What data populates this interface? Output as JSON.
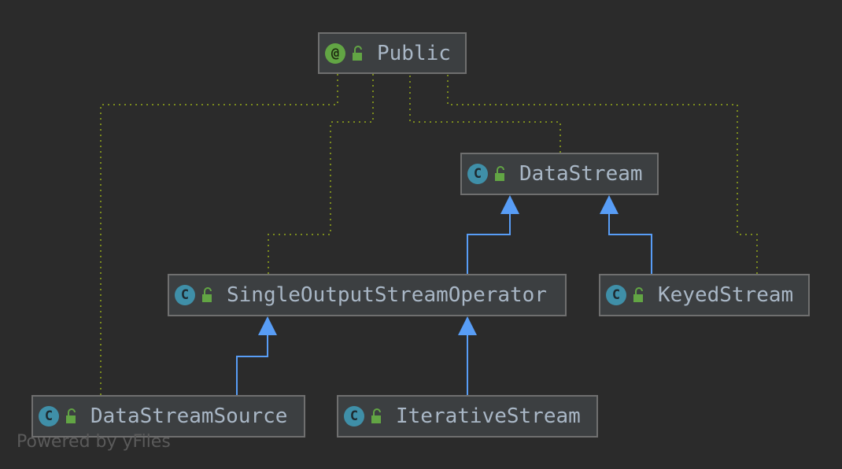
{
  "nodes": {
    "public": {
      "name": "Public",
      "kind": "annotation",
      "kind_letter": "@"
    },
    "datastream": {
      "name": "DataStream",
      "kind": "class",
      "kind_letter": "C"
    },
    "single_output": {
      "name": "SingleOutputStreamOperator",
      "kind": "class",
      "kind_letter": "C"
    },
    "keyed": {
      "name": "KeyedStream",
      "kind": "class",
      "kind_letter": "C"
    },
    "source": {
      "name": "DataStreamSource",
      "kind": "class",
      "kind_letter": "C"
    },
    "iterative": {
      "name": "IterativeStream",
      "kind": "class",
      "kind_letter": "C"
    }
  },
  "edges": {
    "inheritance": [
      {
        "from": "SingleOutputStreamOperator",
        "to": "DataStream"
      },
      {
        "from": "KeyedStream",
        "to": "DataStream"
      },
      {
        "from": "DataStreamSource",
        "to": "SingleOutputStreamOperator"
      },
      {
        "from": "IterativeStream",
        "to": "SingleOutputStreamOperator"
      }
    ],
    "annotated_by": [
      {
        "from": "DataStream",
        "to": "Public"
      },
      {
        "from": "SingleOutputStreamOperator",
        "to": "Public"
      },
      {
        "from": "KeyedStream",
        "to": "Public"
      },
      {
        "from": "DataStreamSource",
        "to": "Public"
      }
    ]
  },
  "colors": {
    "background": "#2b2b2b",
    "node_fill": "#3c3f41",
    "node_border": "#6f6f6f",
    "text": "#a9b7c6",
    "inheritance_edge": "#589df6",
    "annotation_edge": "#7a8a1e",
    "class_icon": "#3f8fa8",
    "annotation_icon": "#62a544",
    "lock_icon": "#62a544"
  },
  "watermark": "Powered by yFiles"
}
